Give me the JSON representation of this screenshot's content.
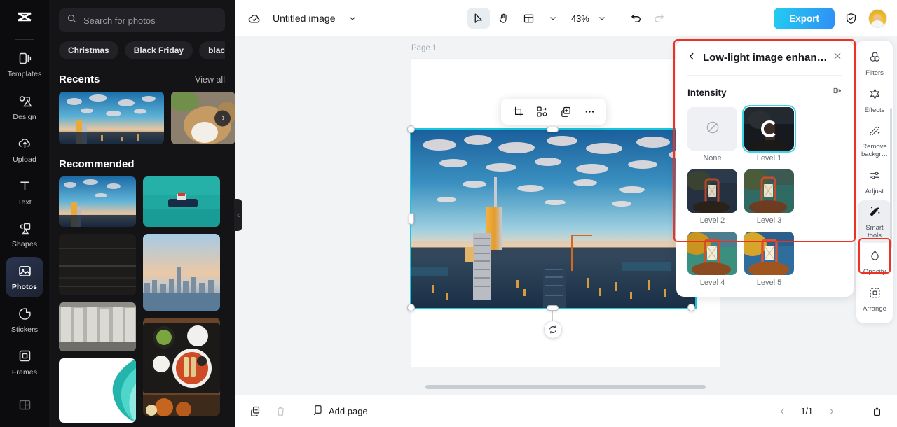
{
  "app": {
    "logo_icon": "capcut-logo-icon"
  },
  "sidebar": {
    "items": [
      {
        "label": "Templates",
        "icon": "templates-icon",
        "active": false
      },
      {
        "label": "Design",
        "icon": "design-icon",
        "active": false
      },
      {
        "label": "Upload",
        "icon": "upload-icon",
        "active": false
      },
      {
        "label": "Text",
        "icon": "text-icon",
        "active": false
      },
      {
        "label": "Shapes",
        "icon": "shapes-icon",
        "active": false
      },
      {
        "label": "Photos",
        "icon": "photos-icon",
        "active": true
      },
      {
        "label": "Stickers",
        "icon": "stickers-icon",
        "active": false
      },
      {
        "label": "Frames",
        "icon": "frames-icon",
        "active": false
      },
      {
        "label": "",
        "icon": "layout-grid-icon",
        "active": false
      }
    ]
  },
  "photos_panel": {
    "search": {
      "placeholder": "Search for photos",
      "value": "",
      "icon": "search-icon"
    },
    "chips": [
      "Christmas",
      "Black Friday",
      "black"
    ],
    "recents": {
      "title": "Recents",
      "view_all": "View all",
      "next_icon": "chevron-right-icon"
    },
    "recommended": {
      "title": "Recommended"
    },
    "collapse_icon": "chevron-left-icon"
  },
  "topbar": {
    "cloud_icon": "cloud-check-icon",
    "doc_title": "Untitled image",
    "title_caret_icon": "chevron-down-icon",
    "select_tool_icon": "cursor-select-icon",
    "hand_tool_icon": "hand-pan-icon",
    "layout_icon": "canvas-layout-icon",
    "layout_caret_icon": "chevron-down-icon",
    "zoom_level": "43%",
    "zoom_caret_icon": "chevron-down-icon",
    "undo_icon": "undo-icon",
    "redo_icon": "redo-icon",
    "export_label": "Export",
    "shield_icon": "shield-check-icon",
    "avatar_name": "avatar"
  },
  "canvas": {
    "page_label": "Page 1",
    "float_toolbar": [
      {
        "icon": "crop-icon"
      },
      {
        "icon": "replace-image-icon"
      },
      {
        "icon": "duplicate-icon"
      },
      {
        "icon": "more-options-icon"
      }
    ],
    "rotate_icon": "rotate-icon",
    "selection_color": "#19c7dd"
  },
  "bottombar": {
    "duplicate_page_icon": "duplicate-page-icon",
    "delete_page_icon": "trash-icon",
    "add_page_label": "Add page",
    "add_page_icon": "add-page-icon",
    "prev_icon": "chevron-left-icon",
    "page_indicator": "1/1",
    "next_icon": "chevron-right-icon",
    "export_icon": "export-upload-icon"
  },
  "property_rail": {
    "items": [
      {
        "label": "Filters",
        "icon": "filters-icon",
        "highlighted": false
      },
      {
        "label": "Effects",
        "icon": "effects-icon",
        "highlighted": false
      },
      {
        "label": "Remove\nbackgr…",
        "icon": "remove-bg-icon",
        "highlighted": false
      },
      {
        "label": "Adjust",
        "icon": "adjust-icon",
        "highlighted": false
      },
      {
        "label": "Smart\ntools",
        "icon": "smart-tools-icon",
        "highlighted": true
      },
      {
        "label": "Opacity",
        "icon": "opacity-icon",
        "highlighted": false
      },
      {
        "label": "Arrange",
        "icon": "arrange-icon",
        "highlighted": false
      }
    ],
    "highlight_color": "#ef3124"
  },
  "ai_panel": {
    "back_icon": "chevron-left-icon",
    "title": "Low-light image enhan…",
    "close_icon": "close-icon",
    "section_label": "Intensity",
    "compare_icon": "compare-icon",
    "selected_level": "Level 1",
    "options": [
      {
        "label": "None",
        "kind": "none",
        "selected": false,
        "loading": false
      },
      {
        "label": "Level 1",
        "kind": "photo",
        "selected": true,
        "loading": true
      },
      {
        "label": "Level 2",
        "kind": "photo",
        "selected": false,
        "loading": false
      },
      {
        "label": "Level 3",
        "kind": "photo",
        "selected": false,
        "loading": false
      },
      {
        "label": "Level 4",
        "kind": "photo",
        "selected": false,
        "loading": false
      },
      {
        "label": "Level 5",
        "kind": "photo",
        "selected": false,
        "loading": false
      }
    ],
    "highlight_color": "#ef3124"
  }
}
